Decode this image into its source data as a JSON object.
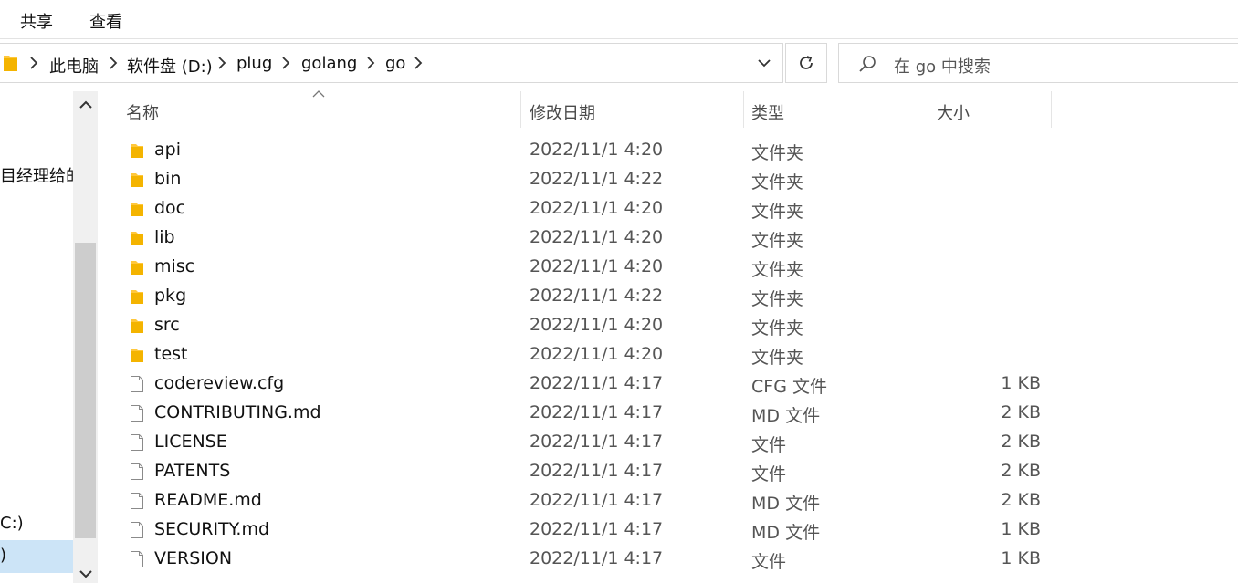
{
  "ribbon": {
    "tabs": [
      "共享",
      "查看"
    ]
  },
  "address": {
    "crumbs": [
      "此电脑",
      "软件盘 (D:)",
      "plug",
      "golang",
      "go"
    ]
  },
  "search": {
    "placeholder": "在 go 中搜索"
  },
  "nav": {
    "items": [
      "目经理给的",
      "C:)",
      ")"
    ]
  },
  "columns": {
    "name": "名称",
    "date": "修改日期",
    "type": "类型",
    "size": "大小"
  },
  "files": [
    {
      "name": "api",
      "date": "2022/11/1 4:20",
      "type": "文件夹",
      "size": "",
      "icon": "folder-icon"
    },
    {
      "name": "bin",
      "date": "2022/11/1 4:22",
      "type": "文件夹",
      "size": "",
      "icon": "folder-icon"
    },
    {
      "name": "doc",
      "date": "2022/11/1 4:20",
      "type": "文件夹",
      "size": "",
      "icon": "folder-icon"
    },
    {
      "name": "lib",
      "date": "2022/11/1 4:20",
      "type": "文件夹",
      "size": "",
      "icon": "folder-icon"
    },
    {
      "name": "misc",
      "date": "2022/11/1 4:20",
      "type": "文件夹",
      "size": "",
      "icon": "folder-icon"
    },
    {
      "name": "pkg",
      "date": "2022/11/1 4:22",
      "type": "文件夹",
      "size": "",
      "icon": "folder-icon"
    },
    {
      "name": "src",
      "date": "2022/11/1 4:20",
      "type": "文件夹",
      "size": "",
      "icon": "folder-icon"
    },
    {
      "name": "test",
      "date": "2022/11/1 4:20",
      "type": "文件夹",
      "size": "",
      "icon": "folder-icon"
    },
    {
      "name": "codereview.cfg",
      "date": "2022/11/1 4:17",
      "type": "CFG 文件",
      "size": "1 KB",
      "icon": "file-icon"
    },
    {
      "name": "CONTRIBUTING.md",
      "date": "2022/11/1 4:17",
      "type": "MD 文件",
      "size": "2 KB",
      "icon": "file-icon"
    },
    {
      "name": "LICENSE",
      "date": "2022/11/1 4:17",
      "type": "文件",
      "size": "2 KB",
      "icon": "file-icon"
    },
    {
      "name": "PATENTS",
      "date": "2022/11/1 4:17",
      "type": "文件",
      "size": "2 KB",
      "icon": "file-icon"
    },
    {
      "name": "README.md",
      "date": "2022/11/1 4:17",
      "type": "MD 文件",
      "size": "2 KB",
      "icon": "file-icon"
    },
    {
      "name": "SECURITY.md",
      "date": "2022/11/1 4:17",
      "type": "MD 文件",
      "size": "1 KB",
      "icon": "file-icon"
    },
    {
      "name": "VERSION",
      "date": "2022/11/1 4:17",
      "type": "文件",
      "size": "1 KB",
      "icon": "file-icon"
    }
  ],
  "colors": {
    "folder": "#ffc83d",
    "selection": "#cce4f7",
    "border": "#d9d9d9"
  }
}
